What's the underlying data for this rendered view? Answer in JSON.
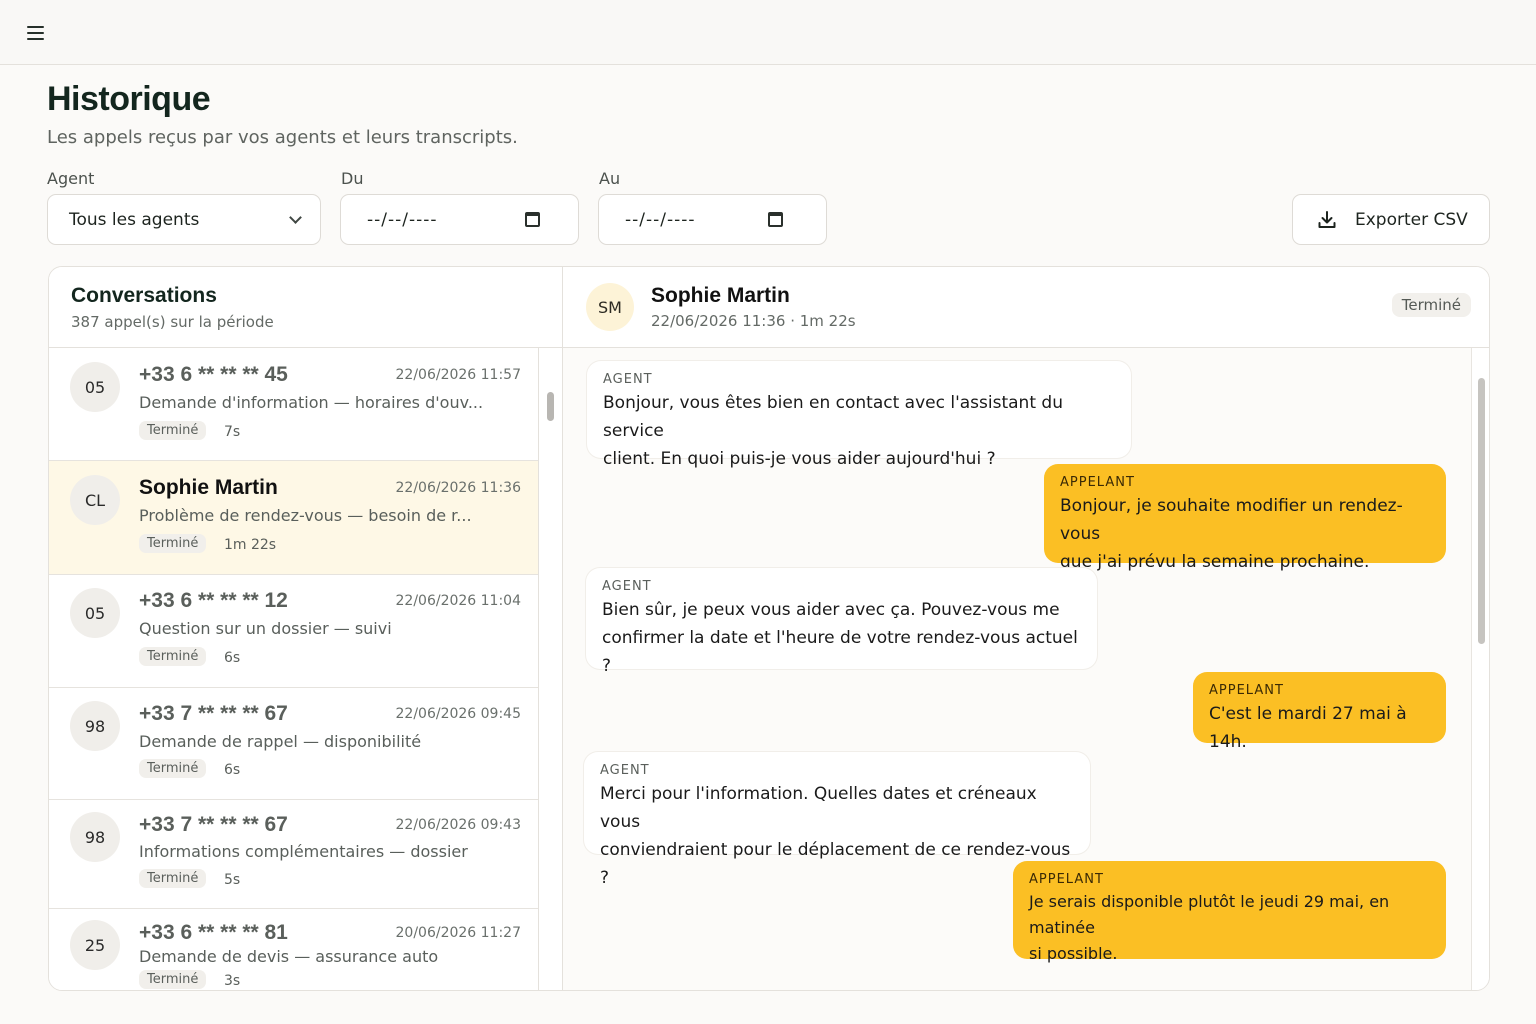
{
  "page": {
    "title": "Historique",
    "subtitle": "Les appels reçus par vos agents et leurs transcripts."
  },
  "filters": {
    "agent_label": "Agent",
    "agent_value": "Tous les agents",
    "du_label": "Du",
    "du_value": "--/--/----",
    "au_label": "Au",
    "au_value": "--/--/----",
    "export_label": "Exporter CSV"
  },
  "conversations": {
    "title": "Conversations",
    "count": "387 appel(s) sur la période",
    "items": [
      {
        "initials": "05",
        "name": "+33 6 ** ** ** 45",
        "datetime": "22/06/2026 11:57",
        "preview": "Demande d'information — horaires d'ouv...",
        "status": "Terminé",
        "duration": "7s"
      },
      {
        "initials": "CL",
        "name": "Sophie Martin",
        "datetime": "22/06/2026 11:36",
        "preview": "Problème de rendez-vous — besoin de r...",
        "status": "Terminé",
        "duration": "1m 22s"
      },
      {
        "initials": "05",
        "name": "+33 6 ** ** ** 12",
        "datetime": "22/06/2026 11:04",
        "preview": "Question sur un dossier — suivi",
        "status": "Terminé",
        "duration": "6s"
      },
      {
        "initials": "98",
        "name": "+33 7 ** ** ** 67",
        "datetime": "22/06/2026 09:45",
        "preview": "Demande de rappel — disponibilité",
        "status": "Terminé",
        "duration": "6s"
      },
      {
        "initials": "98",
        "name": "+33 7 ** ** ** 67",
        "datetime": "22/06/2026 09:43",
        "preview": "Informations complémentaires — dossier",
        "status": "Terminé",
        "duration": "5s"
      },
      {
        "initials": "25",
        "name": "+33 6 ** ** ** 81",
        "datetime": "20/06/2026 11:27",
        "preview": "Demande de devis — assurance auto",
        "status": "Terminé",
        "duration": "3s"
      }
    ]
  },
  "detail": {
    "initials": "SM",
    "name": "Sophie Martin",
    "meta": "22/06/2026 11:36 · 1m 22s",
    "status": "Terminé",
    "messages": [
      {
        "role": "AGENT",
        "lines": [
          "Bonjour, vous êtes bien en contact avec l'assistant du service",
          "client. En quoi puis-je vous aider aujourd'hui ?"
        ]
      },
      {
        "role": "APPELANT",
        "lines": [
          "Bonjour, je souhaite modifier un rendez-vous",
          "que j'ai prévu la semaine prochaine."
        ]
      },
      {
        "role": "AGENT",
        "lines": [
          "Bien sûr, je peux vous aider avec ça. Pouvez-vous me",
          "confirmer la date et l'heure de votre rendez-vous actuel ?"
        ]
      },
      {
        "role": "APPELANT",
        "lines": [
          "C'est le mardi 27 mai à 14h."
        ]
      },
      {
        "role": "AGENT",
        "lines": [
          "Merci pour l'information. Quelles dates et créneaux vous",
          "conviendraient pour le déplacement de ce rendez-vous ?"
        ]
      },
      {
        "role": "APPELANT",
        "lines": [
          "Je serais disponible plutôt le jeudi 29 mai, en matinée",
          "si possible."
        ]
      }
    ]
  }
}
